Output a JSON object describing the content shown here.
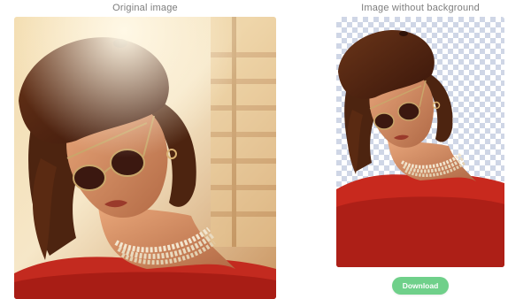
{
  "captions": {
    "original": "Original image",
    "result": "Image without background"
  },
  "actions": {
    "download_label": "Download"
  },
  "colors": {
    "accent_button": "#6fd08a",
    "checker_light": "#ffffff",
    "checker_dark": "#cfd6e6",
    "caption_text": "#7d7d7d"
  }
}
